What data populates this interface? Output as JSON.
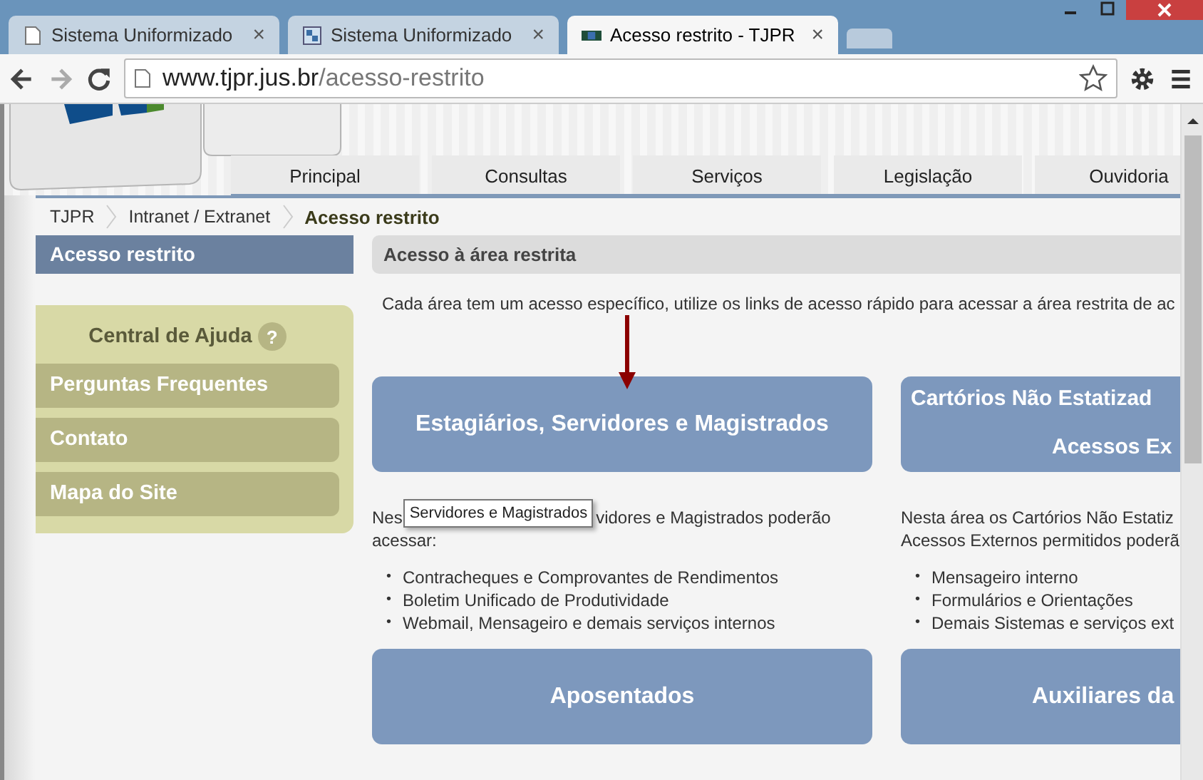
{
  "browser": {
    "tabs": [
      {
        "title": "Sistema Uniformizado",
        "close": "×",
        "selected": false
      },
      {
        "title": "Sistema Uniformizado",
        "close": "×",
        "selected": false
      },
      {
        "title": "Acesso restrito - TJPR",
        "close": "×",
        "selected": true
      }
    ],
    "url_host": "www.tjpr.jus.br",
    "url_path": "/acesso-restrito"
  },
  "nav": [
    {
      "label": "Principal"
    },
    {
      "label": "Consultas"
    },
    {
      "label": "Serviços"
    },
    {
      "label": "Legislação"
    },
    {
      "label": "Ouvidoria"
    }
  ],
  "breadcrumb": [
    {
      "label": "TJPR",
      "current": false
    },
    {
      "label": "Intranet / Extranet",
      "current": false
    },
    {
      "label": "Acesso restrito",
      "current": true
    }
  ],
  "sidebar": {
    "title": "Acesso restrito",
    "help_title": "Central de Ajuda",
    "help_icon": "?",
    "items": [
      {
        "label": "Perguntas Frequentes"
      },
      {
        "label": "Contato"
      },
      {
        "label": "Mapa do Site"
      }
    ]
  },
  "main": {
    "heading": "Acesso à área restrita",
    "intro": "Cada área tem um acesso específico, utilize os links de acesso rápido para acessar a área restrita de ac",
    "columns": [
      {
        "card_lines": [
          "Estagiários, Servidores e Magistrados"
        ],
        "desc_line1_start": "Nes",
        "desc_line1_end": "vidores e Magistrados poderão",
        "desc_line2": "acessar:",
        "tooltip": "Servidores e Magistrados",
        "bullets": [
          {
            "marker": "•",
            "text": "Contracheques e Comprovantes de Rendimentos"
          },
          {
            "marker": "•",
            "text": "Boletim Unificado de Produtividade"
          },
          {
            "marker": "•",
            "text": "Webmail, Mensageiro e demais serviços internos"
          }
        ],
        "next_card": "Aposentados"
      },
      {
        "card_lines": [
          "Cartórios Não Estatizad",
          "Acessos Ex"
        ],
        "desc_line1_start": "Nesta área os Cartórios Não Estatiz",
        "desc_line2": "Acessos Externos permitidos poderã",
        "bullets": [
          {
            "marker": "•",
            "text": "Mensageiro interno"
          },
          {
            "marker": "•",
            "text": "Formulários e Orientações"
          },
          {
            "marker": "•",
            "text": "Demais Sistemas e serviços ext"
          }
        ],
        "next_card": "Auxiliares da"
      }
    ]
  }
}
